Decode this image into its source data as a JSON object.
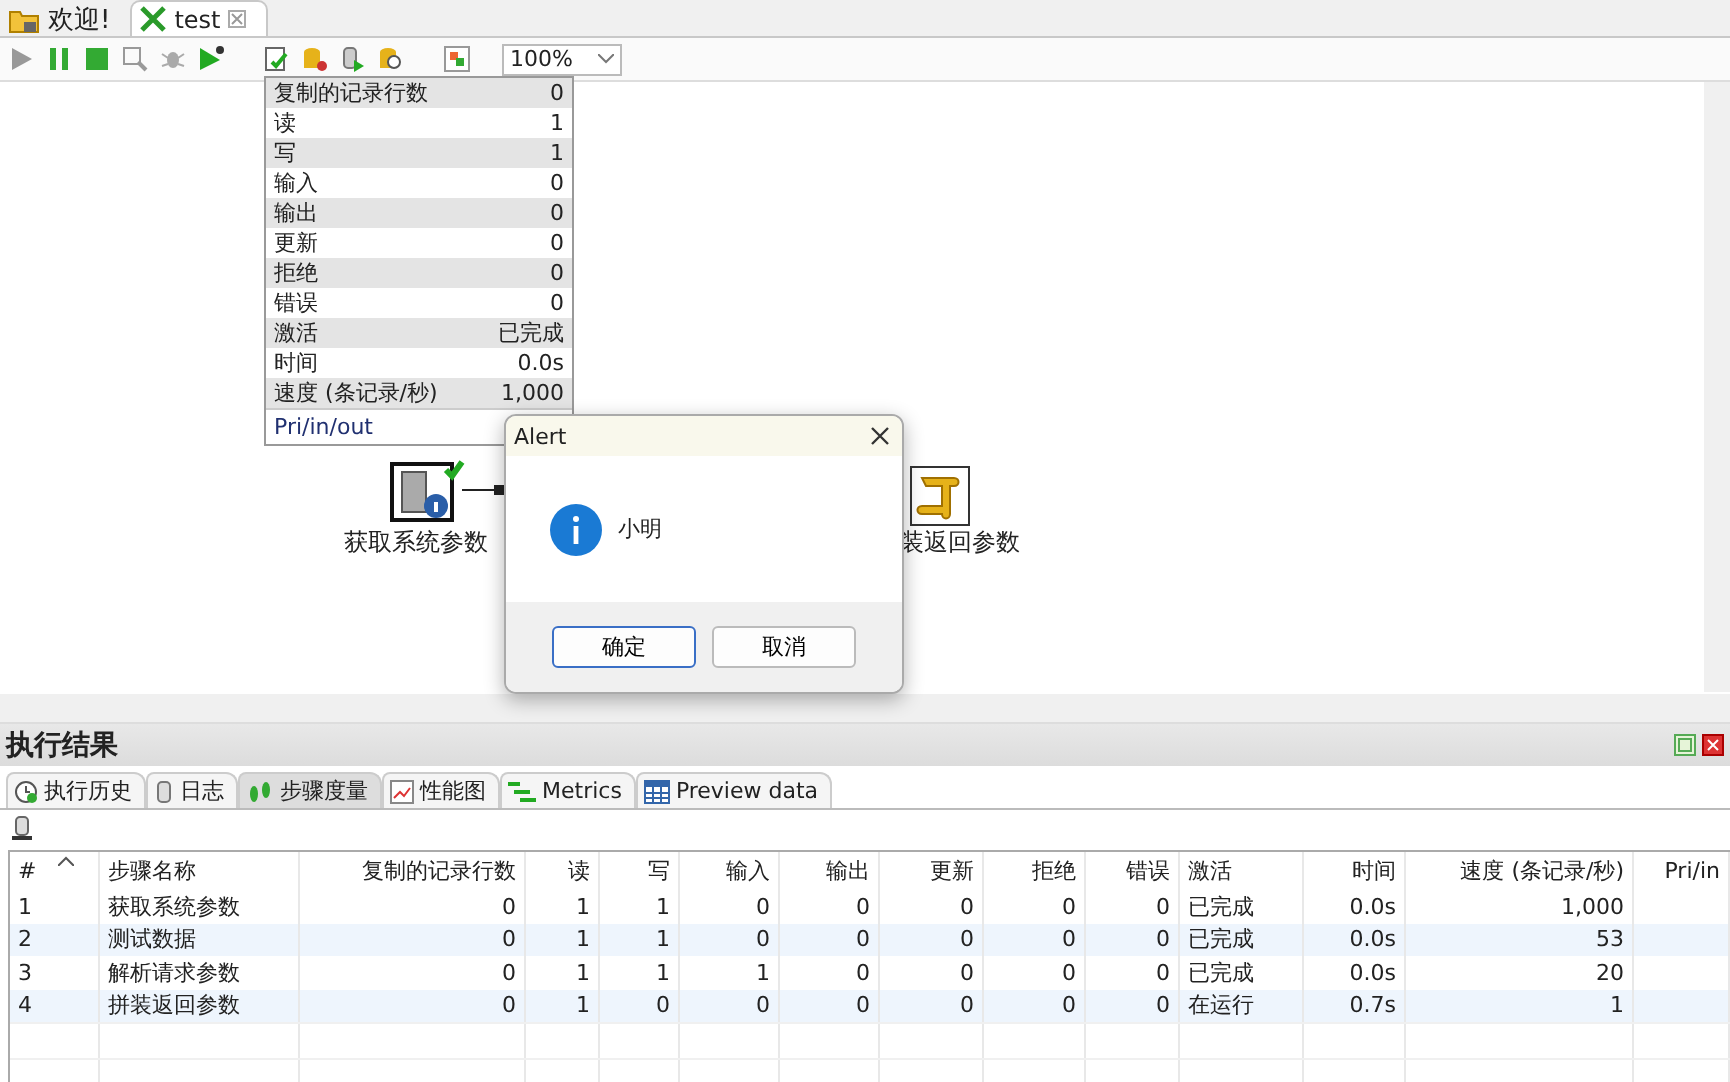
{
  "editor_tabs": [
    {
      "label": "欢迎!",
      "selected": false,
      "closable": false
    },
    {
      "label": "test",
      "selected": true,
      "closable": true
    }
  ],
  "toolbar": {
    "zoom": "100%"
  },
  "canvas": {
    "tooltip": {
      "rows": [
        {
          "label": "复制的记录行数",
          "value": "0"
        },
        {
          "label": "读",
          "value": "1"
        },
        {
          "label": "写",
          "value": "1"
        },
        {
          "label": "输入",
          "value": "0"
        },
        {
          "label": "输出",
          "value": "0"
        },
        {
          "label": "更新",
          "value": "0"
        },
        {
          "label": "拒绝",
          "value": "0"
        },
        {
          "label": "错误",
          "value": "0"
        },
        {
          "label": "激活",
          "value": "已完成"
        },
        {
          "label": "时间",
          "value": "0.0s"
        },
        {
          "label": "速度 (条记录/秒)",
          "value": "1,000"
        }
      ],
      "footer": "Pri/in/out"
    },
    "steps": [
      {
        "label": "获取系统参数",
        "kind": "info",
        "finished": true
      },
      {
        "label": "装返回参数",
        "kind": "script",
        "finished": false
      }
    ]
  },
  "dialog": {
    "title": "Alert",
    "message": "小明",
    "buttons": [
      {
        "label": "确定",
        "focused": true
      },
      {
        "label": "取消",
        "focused": false
      }
    ]
  },
  "results": {
    "title": "执行结果",
    "tabs": [
      {
        "label": "执行历史",
        "selected": false,
        "kind": "history"
      },
      {
        "label": "日志",
        "selected": false,
        "kind": "log"
      },
      {
        "label": "步骤度量",
        "selected": true,
        "kind": "steps"
      },
      {
        "label": "性能图",
        "selected": false,
        "kind": "chart"
      },
      {
        "label": "Metrics",
        "selected": false,
        "kind": "metrics"
      },
      {
        "label": "Preview data",
        "selected": false,
        "kind": "grid"
      }
    ],
    "table": {
      "columns": [
        "#",
        "步骤名称",
        "复制的记录行数",
        "读",
        "写",
        "输入",
        "输出",
        "更新",
        "拒绝",
        "错误",
        "激活",
        "时间",
        "速度 (条记录/秒)",
        "Pri/in"
      ],
      "rows": [
        [
          "1",
          "获取系统参数",
          "0",
          "1",
          "1",
          "0",
          "0",
          "0",
          "0",
          "0",
          "已完成",
          "0.0s",
          "1,000"
        ],
        [
          "2",
          "测试数据",
          "0",
          "1",
          "1",
          "0",
          "0",
          "0",
          "0",
          "0",
          "已完成",
          "0.0s",
          "53"
        ],
        [
          "3",
          "解析请求参数",
          "0",
          "1",
          "1",
          "1",
          "0",
          "0",
          "0",
          "0",
          "已完成",
          "0.0s",
          "20"
        ],
        [
          "4",
          "拼装返回参数",
          "0",
          "1",
          "0",
          "0",
          "0",
          "0",
          "0",
          "0",
          "在运行",
          "0.7s",
          "1"
        ]
      ]
    }
  }
}
